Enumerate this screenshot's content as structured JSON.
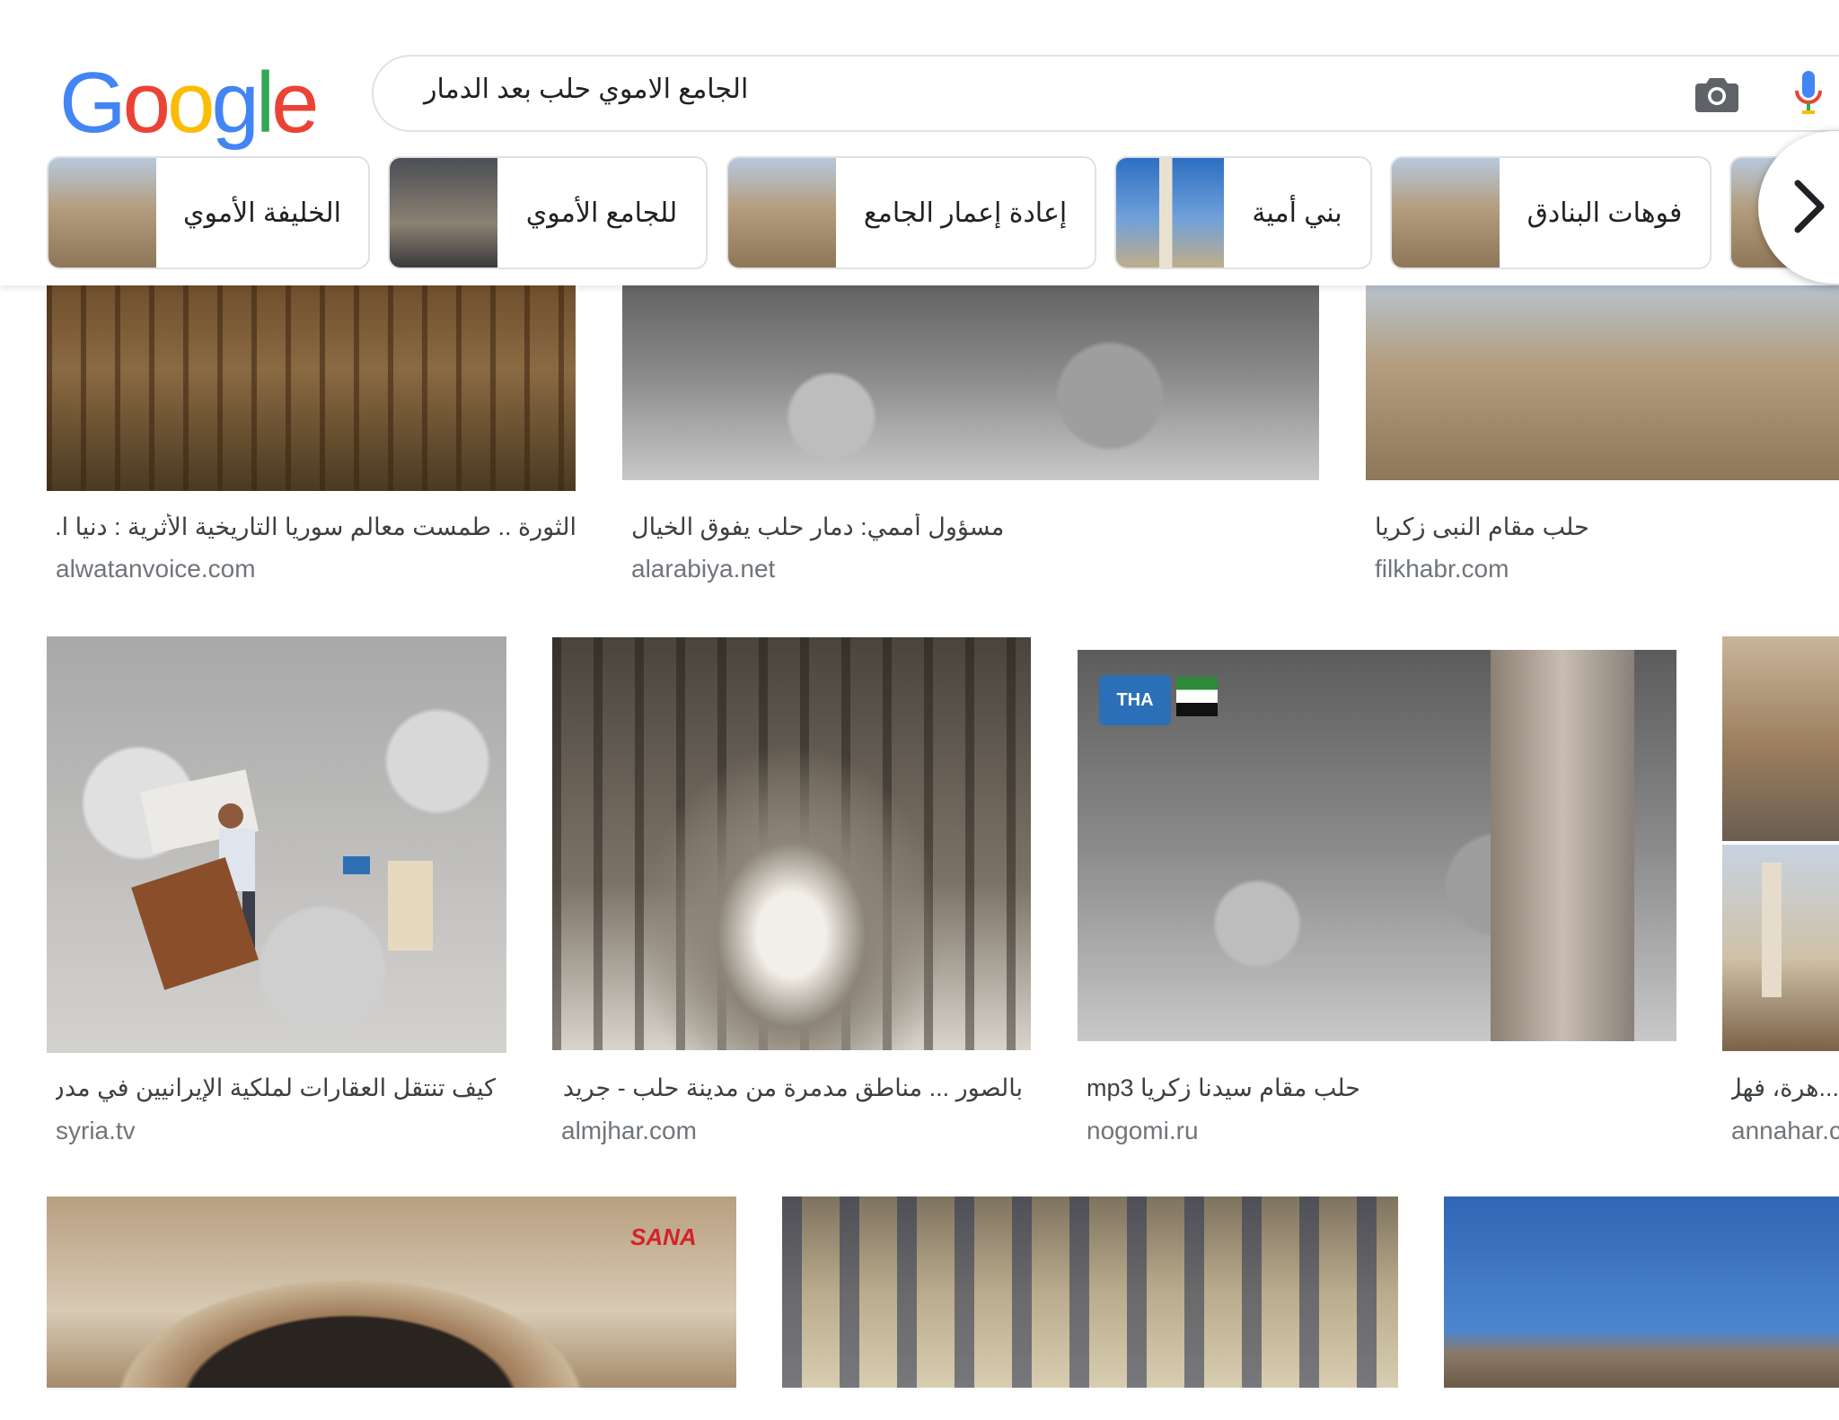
{
  "logo": {
    "g1": "G",
    "o1": "o",
    "o2": "o",
    "g2": "g",
    "l": "l",
    "e": "e"
  },
  "search": {
    "query": "الجامع الاموي حلب بعد الدمار"
  },
  "icons": {
    "camera": "camera-icon",
    "mic": "mic-icon",
    "next": "chevron-right-icon"
  },
  "chips": [
    {
      "label": "الخليفة الأموي"
    },
    {
      "label": "للجامع الأموي"
    },
    {
      "label": "إعادة إعمار الجامع"
    },
    {
      "label": "بني أمية"
    },
    {
      "label": "فوهات البنادق"
    }
  ],
  "results": {
    "row1": [
      {
        "title": "الثورة .. طمست معالم سوريا التاريخية الأثرية : دنيا ا...",
        "source": "alwatanvoice.com"
      },
      {
        "title": "مسؤول أممي: دمار حلب يفوق الخيال",
        "source": "alarabiya.net"
      },
      {
        "title": "حلب مقام النبى زكريا",
        "source": "filkhabr.com"
      }
    ],
    "row2": [
      {
        "title": "كيف تنتقل العقارات لملكية الإيرانيين في مدن ...",
        "source": "syria.tv"
      },
      {
        "title": "بالصور ... مناطق مدمرة من مدينة حلب - جريد...",
        "source": "almjhar.com"
      },
      {
        "title": "حلب مقام سيدنا زكريا mp3",
        "source": "nogomi.ru"
      },
      {
        "title": "...هرة، فهل",
        "source": "annahar.c"
      }
    ]
  },
  "overlays": {
    "tha_logo": "THA",
    "sana_logo": "SANA"
  }
}
